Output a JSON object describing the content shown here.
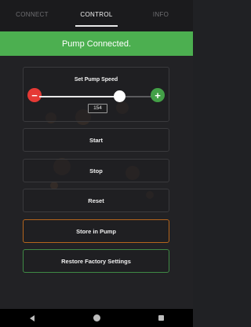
{
  "tabs": [
    {
      "label": "CONNECT",
      "active": false
    },
    {
      "label": "CONTROL",
      "active": true
    },
    {
      "label": "INFO",
      "active": false
    }
  ],
  "banner": {
    "text": "Pump Connected.",
    "color": "#4caf50"
  },
  "speed_control": {
    "title": "Set Pump Speed",
    "value": "154",
    "slider_fraction": 0.7,
    "minus_icon": "minus-icon",
    "plus_icon": "plus-icon",
    "minus_color": "#e53935",
    "plus_color": "#43a047"
  },
  "buttons": {
    "start": "Start",
    "stop": "Stop",
    "reset": "Reset",
    "store": "Store in Pump",
    "restore": "Restore Factory Settings"
  },
  "colors": {
    "store_border": "#b5651d",
    "restore_border": "#3f8a45"
  },
  "navbar": {
    "back_icon": "back-icon",
    "home_icon": "home-icon",
    "recents_icon": "recents-icon"
  }
}
